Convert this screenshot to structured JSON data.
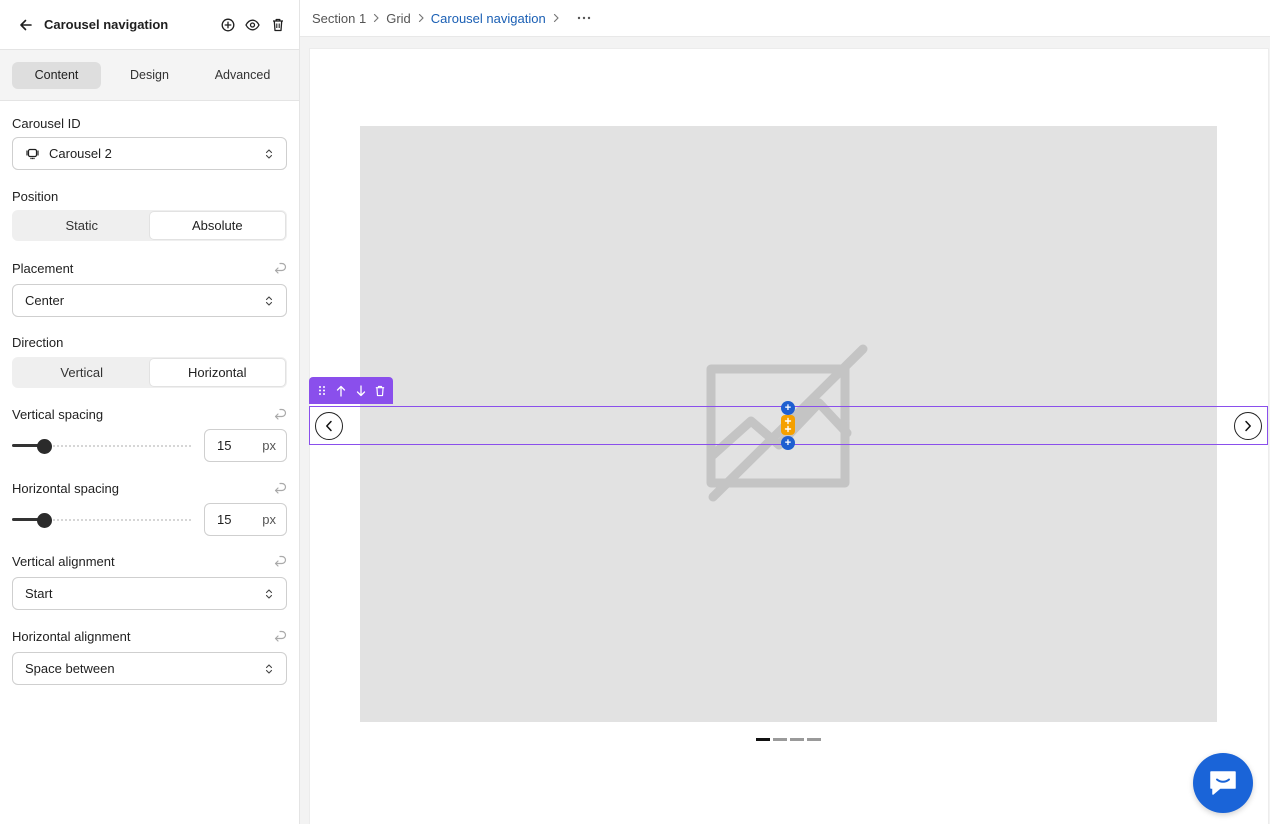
{
  "sidebar": {
    "title": "Carousel navigation",
    "tabs": [
      {
        "label": "Content"
      },
      {
        "label": "Design"
      },
      {
        "label": "Advanced"
      }
    ],
    "carousel_id": {
      "label": "Carousel ID",
      "value": "Carousel 2"
    },
    "position": {
      "label": "Position",
      "options": [
        "Static",
        "Absolute"
      ],
      "selected": "Absolute"
    },
    "placement": {
      "label": "Placement",
      "value": "Center"
    },
    "direction": {
      "label": "Direction",
      "options": [
        "Vertical",
        "Horizontal"
      ],
      "selected": "Horizontal"
    },
    "vertical_spacing": {
      "label": "Vertical spacing",
      "value": "15",
      "unit": "px",
      "slider_fraction": 0.18
    },
    "horizontal_spacing": {
      "label": "Horizontal spacing",
      "value": "15",
      "unit": "px",
      "slider_fraction": 0.18
    },
    "vertical_alignment": {
      "label": "Vertical alignment",
      "value": "Start"
    },
    "horizontal_alignment": {
      "label": "Horizontal alignment",
      "value": "Space between"
    }
  },
  "breadcrumb": {
    "items": [
      "Section 1",
      "Grid",
      "Carousel navigation"
    ]
  },
  "canvas": {
    "pagination_dots": 4,
    "active_dot": 0
  },
  "colors": {
    "accent_purple": "#8a4fec",
    "link_blue": "#1a5fb4",
    "chat_blue": "#1a64d8",
    "insert_blue": "#1e5fd0",
    "insert_orange": "#f5a000",
    "slide_gray": "#e2e2e2"
  },
  "icons": {
    "back": "arrow-left-icon",
    "add": "plus-circle-icon",
    "visibility": "eye-icon",
    "delete": "trash-icon",
    "reset": "reset-arrow-icon",
    "select": "chevron-updown-icon",
    "carousel": "carousel-icon",
    "drag": "drag-handle-icon",
    "move_up": "arrow-up-icon",
    "move_down": "arrow-down-icon",
    "prev": "chevron-left-icon",
    "next": "chevron-right-icon",
    "placeholder": "image-placeholder-icon",
    "chat": "chat-bubble-icon"
  }
}
